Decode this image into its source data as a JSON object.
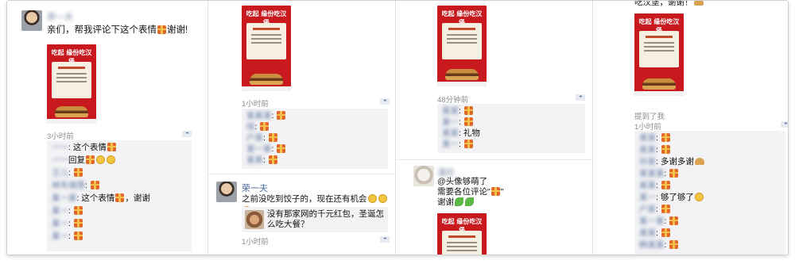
{
  "panel1": {
    "name": "荣一夫",
    "message": "亲们，帮我评论下这个表情",
    "message_tail": "谢谢!",
    "poster_title": "吃起 缘份吃汉堡",
    "time": "3小时前",
    "comments": [
      {
        "name": "一一",
        "text": "这个表情"
      },
      {
        "name": "一一",
        "text": "回复"
      },
      {
        "name": "王儿",
        "text": ""
      },
      {
        "name": "林冬瑞雪",
        "text": ""
      },
      {
        "name": "某一某",
        "text": "这个表情",
        "tail": "，谢谢"
      },
      {
        "name": "某一",
        "text": ""
      },
      {
        "name": "某一",
        "text": ""
      },
      {
        "name": "某一",
        "text": ""
      }
    ]
  },
  "panel2": {
    "poster_title": "吃起 缘份吃汉堡",
    "time": "1小时前",
    "comments": [
      {
        "name": "某某某",
        "text": ""
      },
      {
        "name": "钱",
        "text": ""
      },
      {
        "name": "户某",
        "text": ""
      },
      {
        "name": "某一某",
        "text": ""
      },
      {
        "name": "某某",
        "text": ""
      }
    ],
    "post2": {
      "name": "荣一夫",
      "message": "之前没吃到饺子的，现在还有机会",
      "share_text": "没有那家网的千元红包，圣诞怎么吃大餐？",
      "time": "1小时前"
    }
  },
  "panel3": {
    "poster_title": "吃起 缘份吃汉堡",
    "time": "48分钟前",
    "comments": [
      {
        "name": "某某",
        "text": ""
      },
      {
        "name": "某一",
        "text": ""
      },
      {
        "name": "某某",
        "text": "礼物"
      },
      {
        "name": "某一",
        "text": ""
      }
    ],
    "post2": {
      "name": "潘欢",
      "line1": "@头像够萌了",
      "line2": "需要各位评论\"",
      "line2_tail": "\"",
      "line3": "谢谢"
    }
  },
  "panel4": {
    "top_text": "吃汉堡，谢谢！",
    "poster_title": "吃起 缘份吃汉堡",
    "mention": "提到了我",
    "time": "1小时前",
    "comments": [
      {
        "name": "某某",
        "text": ""
      },
      {
        "name": "某某",
        "text": ""
      },
      {
        "name": "孙某",
        "text": "多谢多谢"
      },
      {
        "name": "某某某",
        "text": ""
      },
      {
        "name": "某某",
        "text": ""
      },
      {
        "name": "某一",
        "text": "够了够了"
      },
      {
        "name": "户某",
        "text": ""
      },
      {
        "name": "某一某",
        "text": ""
      },
      {
        "name": "某某",
        "text": ""
      },
      {
        "name": "韩某某",
        "text": ""
      }
    ]
  }
}
